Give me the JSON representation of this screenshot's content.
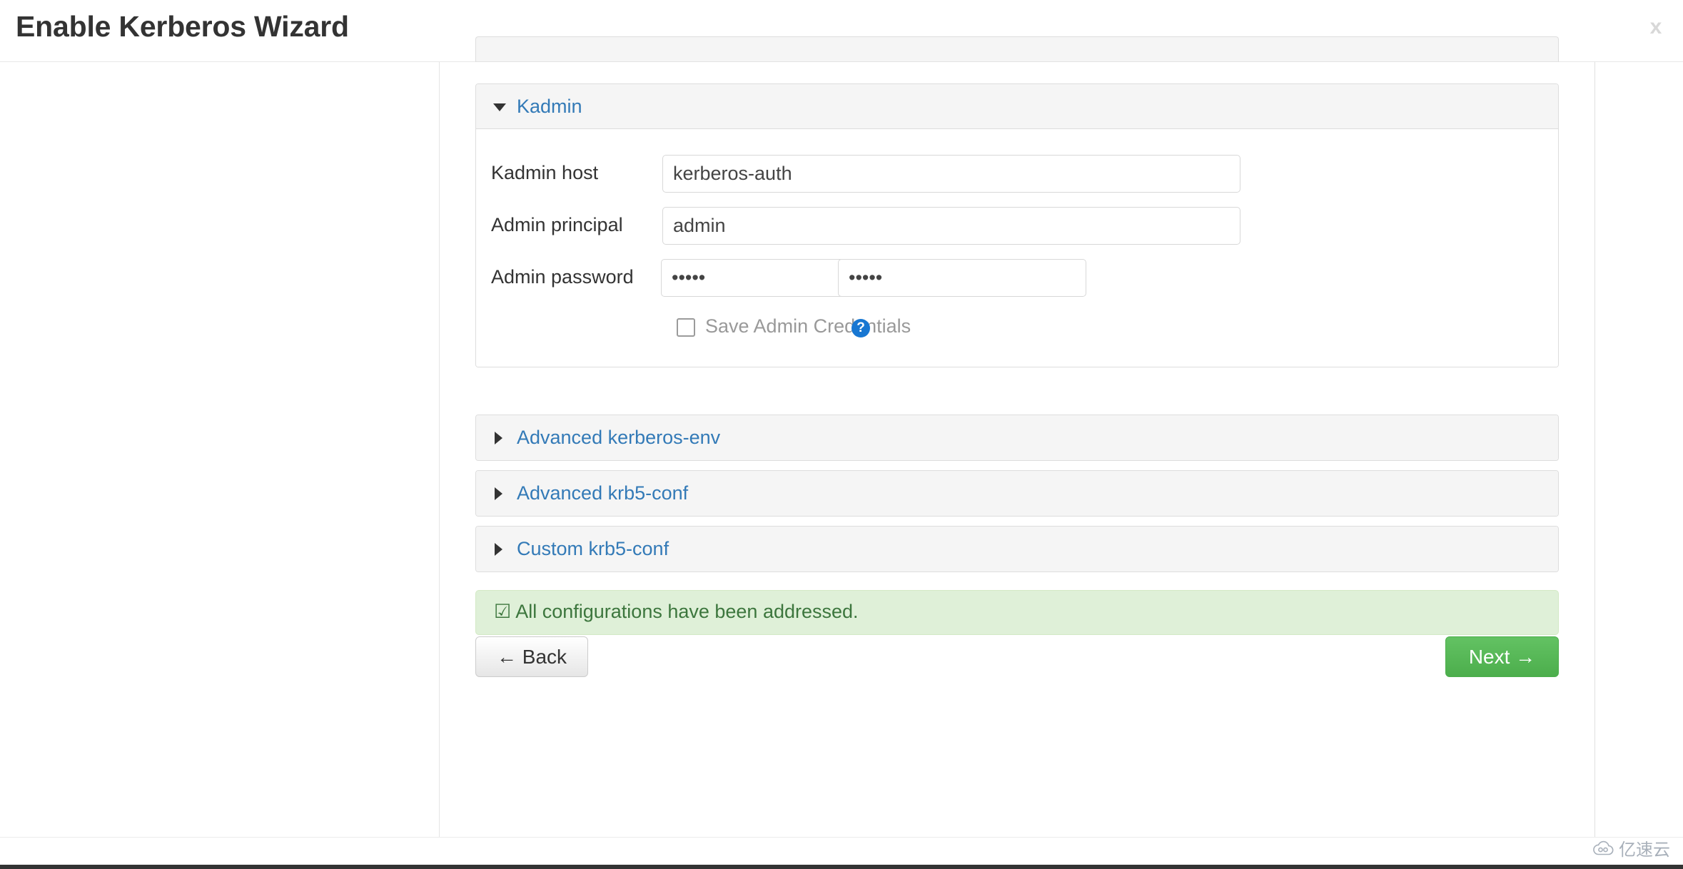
{
  "header": {
    "title": "Enable Kerberos Wizard",
    "close_label": "x"
  },
  "kadmin_panel": {
    "title": "Kadmin",
    "expanded": true,
    "fields": [
      {
        "label": "Kadmin host",
        "value": "kerberos-auth",
        "type": "text"
      },
      {
        "label": "Admin principal",
        "value": "admin",
        "type": "text"
      },
      {
        "label": "Admin password",
        "value": "•••••",
        "confirm_value": "•••••",
        "type": "password"
      }
    ],
    "checkbox": {
      "label": "Save Admin Credentials",
      "checked": false,
      "help_icon_label": "?"
    }
  },
  "collapsed_panels": [
    {
      "title": "Advanced kerberos-env"
    },
    {
      "title": "Advanced krb5-conf"
    },
    {
      "title": "Custom krb5-conf"
    }
  ],
  "alert": {
    "icon": "☑",
    "message": "All configurations have been addressed."
  },
  "footer_buttons": {
    "back_label": "← Back",
    "next_label": "Next →"
  },
  "watermark": {
    "text": "亿速云"
  },
  "colors": {
    "link_blue": "#337ab7",
    "help_blue": "#1877d2",
    "alert_bg": "#dff0d8",
    "alert_text": "#3c763d",
    "next_green": "#4cae4c",
    "panel_header_bg": "#f5f5f5"
  }
}
